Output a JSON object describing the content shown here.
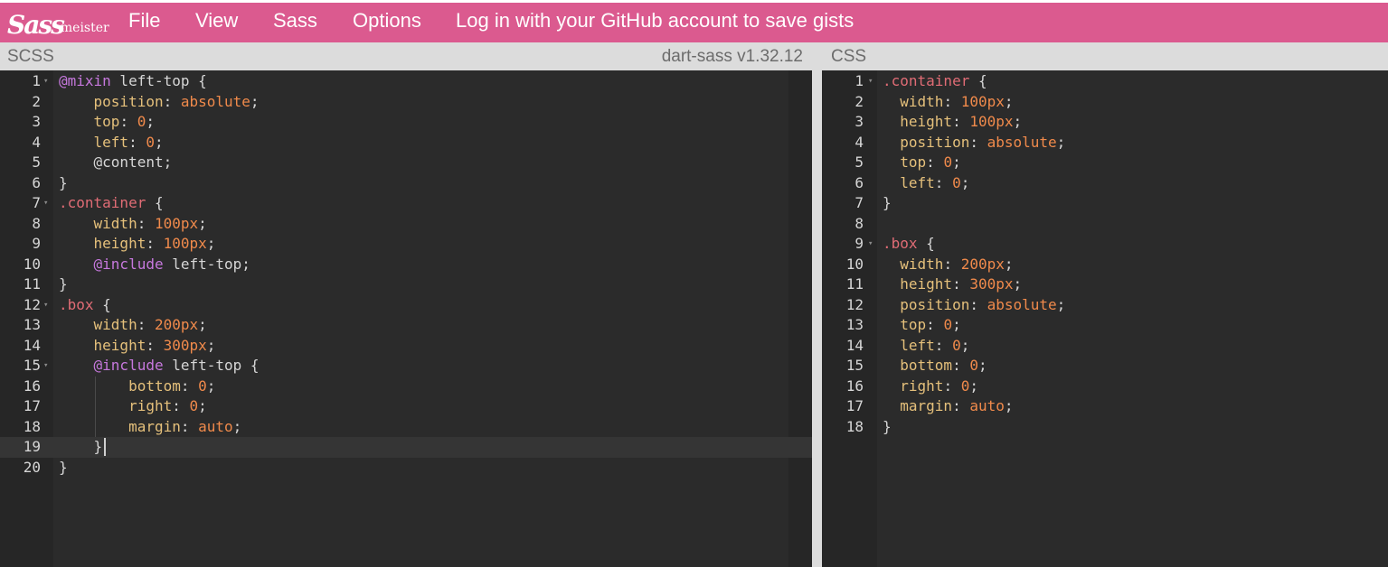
{
  "nav": {
    "logo_script": "Sass",
    "logo_word": "meister",
    "menu": [
      {
        "label": "File",
        "name": "menu-file"
      },
      {
        "label": "View",
        "name": "menu-view"
      },
      {
        "label": "Sass",
        "name": "menu-sass"
      },
      {
        "label": "Options",
        "name": "menu-options"
      },
      {
        "label": "Log in with your GitHub account to save gists",
        "name": "login-github-link"
      }
    ]
  },
  "scss_pane": {
    "title": "SCSS",
    "version": "dart-sass v1.32.12",
    "active_line": 19,
    "lines": [
      {
        "n": "1",
        "fold": true,
        "tokens": [
          [
            "@mixin",
            "kw"
          ],
          [
            " left-top {",
            "plain"
          ]
        ]
      },
      {
        "n": "2",
        "tokens": [
          [
            "    ",
            "plain"
          ],
          [
            "position",
            "prop"
          ],
          [
            ": ",
            "plain"
          ],
          [
            "absolute",
            "val"
          ],
          [
            ";",
            "plain"
          ]
        ]
      },
      {
        "n": "3",
        "tokens": [
          [
            "    ",
            "plain"
          ],
          [
            "top",
            "prop"
          ],
          [
            ": ",
            "plain"
          ],
          [
            "0",
            "num"
          ],
          [
            ";",
            "plain"
          ]
        ]
      },
      {
        "n": "4",
        "tokens": [
          [
            "    ",
            "plain"
          ],
          [
            "left",
            "prop"
          ],
          [
            ": ",
            "plain"
          ],
          [
            "0",
            "num"
          ],
          [
            ";",
            "plain"
          ]
        ]
      },
      {
        "n": "5",
        "tokens": [
          [
            "    @content;",
            "plain"
          ]
        ]
      },
      {
        "n": "6",
        "tokens": [
          [
            "}",
            "plain"
          ]
        ]
      },
      {
        "n": "7",
        "fold": true,
        "tokens": [
          [
            ".container",
            "sel"
          ],
          [
            " {",
            "plain"
          ]
        ]
      },
      {
        "n": "8",
        "tokens": [
          [
            "    ",
            "plain"
          ],
          [
            "width",
            "prop"
          ],
          [
            ": ",
            "plain"
          ],
          [
            "100px",
            "num"
          ],
          [
            ";",
            "plain"
          ]
        ]
      },
      {
        "n": "9",
        "tokens": [
          [
            "    ",
            "plain"
          ],
          [
            "height",
            "prop"
          ],
          [
            ": ",
            "plain"
          ],
          [
            "100px",
            "num"
          ],
          [
            ";",
            "plain"
          ]
        ]
      },
      {
        "n": "10",
        "tokens": [
          [
            "    ",
            "plain"
          ],
          [
            "@include",
            "kw"
          ],
          [
            " left-top;",
            "plain"
          ]
        ]
      },
      {
        "n": "11",
        "tokens": [
          [
            "}",
            "plain"
          ]
        ]
      },
      {
        "n": "12",
        "fold": true,
        "tokens": [
          [
            ".box",
            "sel"
          ],
          [
            " {",
            "plain"
          ]
        ]
      },
      {
        "n": "13",
        "tokens": [
          [
            "    ",
            "plain"
          ],
          [
            "width",
            "prop"
          ],
          [
            ": ",
            "plain"
          ],
          [
            "200px",
            "num"
          ],
          [
            ";",
            "plain"
          ]
        ]
      },
      {
        "n": "14",
        "tokens": [
          [
            "    ",
            "plain"
          ],
          [
            "height",
            "prop"
          ],
          [
            ": ",
            "plain"
          ],
          [
            "300px",
            "num"
          ],
          [
            ";",
            "plain"
          ]
        ]
      },
      {
        "n": "15",
        "fold": true,
        "tokens": [
          [
            "    ",
            "plain"
          ],
          [
            "@include",
            "kw"
          ],
          [
            " left-top {",
            "plain"
          ]
        ]
      },
      {
        "n": "16",
        "tokens": [
          [
            "        ",
            "plain"
          ],
          [
            "bottom",
            "prop"
          ],
          [
            ": ",
            "plain"
          ],
          [
            "0",
            "num"
          ],
          [
            ";",
            "plain"
          ]
        ]
      },
      {
        "n": "17",
        "tokens": [
          [
            "        ",
            "plain"
          ],
          [
            "right",
            "prop"
          ],
          [
            ": ",
            "plain"
          ],
          [
            "0",
            "num"
          ],
          [
            ";",
            "plain"
          ]
        ]
      },
      {
        "n": "18",
        "tokens": [
          [
            "        ",
            "plain"
          ],
          [
            "margin",
            "prop"
          ],
          [
            ": ",
            "plain"
          ],
          [
            "auto",
            "val"
          ],
          [
            ";",
            "plain"
          ]
        ]
      },
      {
        "n": "19",
        "tokens": [
          [
            "    }",
            "plain"
          ]
        ]
      },
      {
        "n": "20",
        "tokens": [
          [
            "}",
            "plain"
          ]
        ]
      }
    ]
  },
  "css_pane": {
    "title": "CSS",
    "lines": [
      {
        "n": "1",
        "fold": true,
        "tokens": [
          [
            ".container",
            "sel"
          ],
          [
            " {",
            "plain"
          ]
        ]
      },
      {
        "n": "2",
        "tokens": [
          [
            "  ",
            "plain"
          ],
          [
            "width",
            "prop"
          ],
          [
            ": ",
            "plain"
          ],
          [
            "100px",
            "num"
          ],
          [
            ";",
            "plain"
          ]
        ]
      },
      {
        "n": "3",
        "tokens": [
          [
            "  ",
            "plain"
          ],
          [
            "height",
            "prop"
          ],
          [
            ": ",
            "plain"
          ],
          [
            "100px",
            "num"
          ],
          [
            ";",
            "plain"
          ]
        ]
      },
      {
        "n": "4",
        "tokens": [
          [
            "  ",
            "plain"
          ],
          [
            "position",
            "prop"
          ],
          [
            ": ",
            "plain"
          ],
          [
            "absolute",
            "val"
          ],
          [
            ";",
            "plain"
          ]
        ]
      },
      {
        "n": "5",
        "tokens": [
          [
            "  ",
            "plain"
          ],
          [
            "top",
            "prop"
          ],
          [
            ": ",
            "plain"
          ],
          [
            "0",
            "num"
          ],
          [
            ";",
            "plain"
          ]
        ]
      },
      {
        "n": "6",
        "tokens": [
          [
            "  ",
            "plain"
          ],
          [
            "left",
            "prop"
          ],
          [
            ": ",
            "plain"
          ],
          [
            "0",
            "num"
          ],
          [
            ";",
            "plain"
          ]
        ]
      },
      {
        "n": "7",
        "tokens": [
          [
            "}",
            "plain"
          ]
        ]
      },
      {
        "n": "8",
        "tokens": []
      },
      {
        "n": "9",
        "fold": true,
        "tokens": [
          [
            ".box",
            "sel"
          ],
          [
            " {",
            "plain"
          ]
        ]
      },
      {
        "n": "10",
        "tokens": [
          [
            "  ",
            "plain"
          ],
          [
            "width",
            "prop"
          ],
          [
            ": ",
            "plain"
          ],
          [
            "200px",
            "num"
          ],
          [
            ";",
            "plain"
          ]
        ]
      },
      {
        "n": "11",
        "tokens": [
          [
            "  ",
            "plain"
          ],
          [
            "height",
            "prop"
          ],
          [
            ": ",
            "plain"
          ],
          [
            "300px",
            "num"
          ],
          [
            ";",
            "plain"
          ]
        ]
      },
      {
        "n": "12",
        "tokens": [
          [
            "  ",
            "plain"
          ],
          [
            "position",
            "prop"
          ],
          [
            ": ",
            "plain"
          ],
          [
            "absolute",
            "val"
          ],
          [
            ";",
            "plain"
          ]
        ]
      },
      {
        "n": "13",
        "tokens": [
          [
            "  ",
            "plain"
          ],
          [
            "top",
            "prop"
          ],
          [
            ": ",
            "plain"
          ],
          [
            "0",
            "num"
          ],
          [
            ";",
            "plain"
          ]
        ]
      },
      {
        "n": "14",
        "tokens": [
          [
            "  ",
            "plain"
          ],
          [
            "left",
            "prop"
          ],
          [
            ": ",
            "plain"
          ],
          [
            "0",
            "num"
          ],
          [
            ";",
            "plain"
          ]
        ]
      },
      {
        "n": "15",
        "tokens": [
          [
            "  ",
            "plain"
          ],
          [
            "bottom",
            "prop"
          ],
          [
            ": ",
            "plain"
          ],
          [
            "0",
            "num"
          ],
          [
            ";",
            "plain"
          ]
        ]
      },
      {
        "n": "16",
        "tokens": [
          [
            "  ",
            "plain"
          ],
          [
            "right",
            "prop"
          ],
          [
            ": ",
            "plain"
          ],
          [
            "0",
            "num"
          ],
          [
            ";",
            "plain"
          ]
        ]
      },
      {
        "n": "17",
        "tokens": [
          [
            "  ",
            "plain"
          ],
          [
            "margin",
            "prop"
          ],
          [
            ": ",
            "plain"
          ],
          [
            "auto",
            "val"
          ],
          [
            ";",
            "plain"
          ]
        ]
      },
      {
        "n": "18",
        "tokens": [
          [
            "}",
            "plain"
          ]
        ]
      }
    ]
  },
  "colors": {
    "nav_bg": "#db5a8f",
    "editor_bg": "#2b2b2b",
    "kw": "#c678dd",
    "sel": "#e06c75",
    "prop": "#e5c07b",
    "num": "#f08a4b",
    "val": "#f08a4b",
    "plain": "#d6d6d6"
  }
}
